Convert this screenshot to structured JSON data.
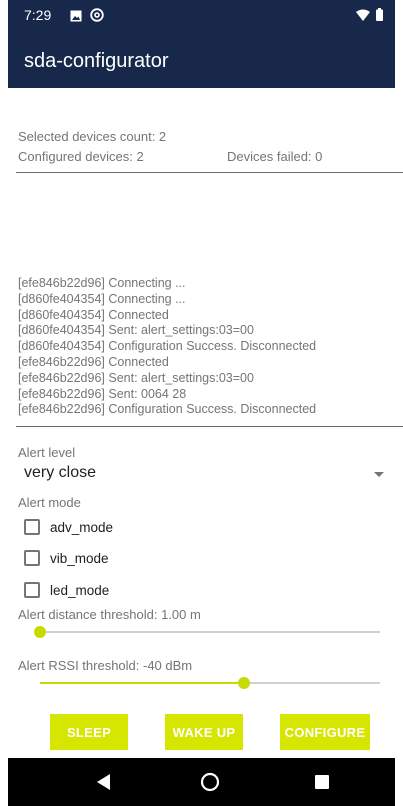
{
  "status_bar": {
    "time": "7:29",
    "icons_left": [
      "image-icon",
      "at-sign-icon"
    ],
    "icons_right": [
      "wifi-icon",
      "battery-icon"
    ]
  },
  "app_bar": {
    "title": "sda-configurator"
  },
  "summary": {
    "selected": "Selected devices count: 2",
    "configured": "Configured devices: 2",
    "failed": "Devices failed: 0"
  },
  "log": [
    "[efe846b22d96] Connecting ...",
    "[d860fe404354] Connecting ...",
    "[d860fe404354] Connected",
    "[d860fe404354] Sent: alert_settings:03=00",
    "[d860fe404354] Configuration Success. Disconnected",
    "[efe846b22d96] Connected",
    "[efe846b22d96] Sent: alert_settings:03=00",
    "[efe846b22d96] Sent: 0064 28",
    "[efe846b22d96] Configuration Success. Disconnected"
  ],
  "alert_level": {
    "label": "Alert level",
    "value": "very close"
  },
  "alert_mode": {
    "label": "Alert mode",
    "options": [
      {
        "label": "adv_mode",
        "checked": false
      },
      {
        "label": "vib_mode",
        "checked": false
      },
      {
        "label": "led_mode",
        "checked": false
      }
    ]
  },
  "distance_threshold": {
    "label": "Alert distance threshold: 1.00 m",
    "level": 0.0
  },
  "rssi_threshold": {
    "label": "Alert RSSI threshold: -40 dBm",
    "level": 0.6
  },
  "buttons": {
    "sleep": "SLEEP",
    "wake_up": "WAKE UP",
    "configure": "CONFIGURE"
  },
  "colors": {
    "app_bar": "#17284a",
    "accent": "#d6e600",
    "slider": "#c6dc00"
  },
  "nav_icons": [
    "back-icon",
    "home-icon",
    "recents-icon"
  ]
}
